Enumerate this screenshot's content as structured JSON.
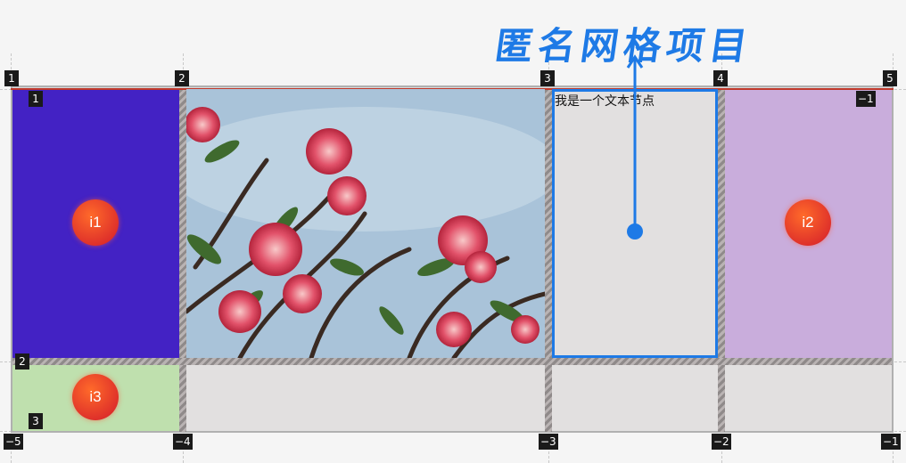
{
  "title": "匿名网格项目",
  "colors": {
    "accent": "#1e7ae6",
    "item_i1_bg": "#4322c4",
    "item_i2_bg": "#c9addc",
    "item_i3_bg": "#bfe0ae",
    "empty_cell_bg": "#e2e0e0",
    "gap_hatch": "#9c9696"
  },
  "column_line_numbers_top": [
    "1",
    "2",
    "3",
    "4",
    "5"
  ],
  "column_line_numbers_bottom": [
    "−5",
    "−4",
    "−3",
    "−2",
    "−1"
  ],
  "row_line_numbers_left": [
    "1",
    "2",
    "3"
  ],
  "row_line_number_right_top": "−1",
  "items": {
    "i1": {
      "label": "i1"
    },
    "i2": {
      "label": "i2"
    },
    "i3": {
      "label": "i3"
    }
  },
  "anonymous_text_node": "我是一个文本节点",
  "image_description_icon": "flower-photo"
}
